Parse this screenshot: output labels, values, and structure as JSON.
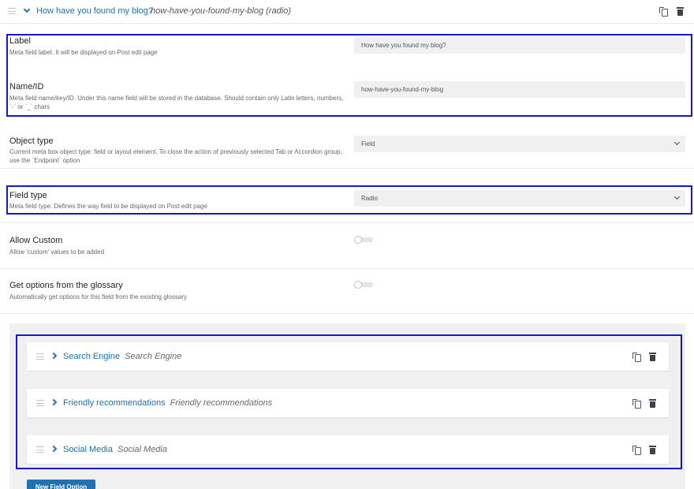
{
  "header": {
    "title": "How have you found my blog?",
    "subtitle": "how-have-you-found-my-blog (radio)"
  },
  "label_row": {
    "title": "Label",
    "description": "Meta field label. It will be displayed on Post edit page",
    "value": "How have you found my blog?"
  },
  "name_row": {
    "title": "Name/ID",
    "description": "Meta field name/key/ID. Under this name field will be stored in the database. Should contain only Latin letters, numbers, `-` or `_` chars",
    "value": "how-have-you-found-my-blog"
  },
  "object_type_row": {
    "title": "Object type",
    "description": "Current meta box object type: field or layout element. To close the action of previously selected Tab or Accordion group, use the `Endpoint` option",
    "value": "Field"
  },
  "field_type_row": {
    "title": "Field type",
    "description": "Meta field type. Defines the way field to be displayed on Post edit page",
    "value": "Radio"
  },
  "allow_custom_row": {
    "title": "Allow Custom",
    "description": "Allow 'custom' values to be added",
    "enabled": false
  },
  "glossary_row": {
    "title": "Get options from the glossary",
    "description": "Automatically get options for this field from the existing glossary",
    "enabled": false
  },
  "options": [
    {
      "label": "Search Engine",
      "value": "Search Engine"
    },
    {
      "label": "Friendly recommendations",
      "value": "Friendly recommendations"
    },
    {
      "label": "Social Media",
      "value": "Social Media"
    }
  ],
  "new_option_button": "New Field Option",
  "colors": {
    "accent": "#2271b1",
    "highlight": "#1515d8",
    "field_bg": "#f0f0f1"
  },
  "icons": [
    "drag-handle-icon",
    "chevron-down-icon",
    "chevron-right-icon",
    "copy-icon",
    "trash-icon"
  ]
}
